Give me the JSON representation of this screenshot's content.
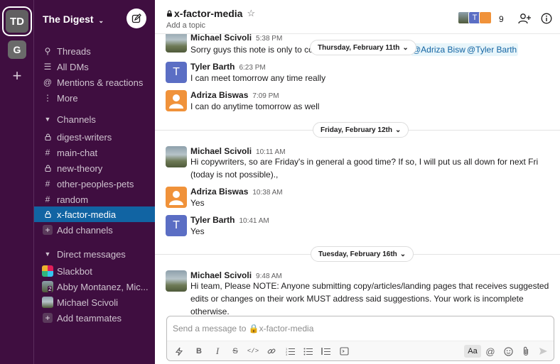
{
  "workspace": {
    "initials_active": "TD",
    "initials_second": "G",
    "add_symbol": "+",
    "name": "The Digest"
  },
  "sidebar": {
    "nav": [
      {
        "label": "Threads",
        "icon": "threads-icon"
      },
      {
        "label": "All DMs",
        "icon": "dms-icon"
      },
      {
        "label": "Mentions & reactions",
        "icon": "at-icon"
      },
      {
        "label": "More",
        "icon": "more-icon"
      }
    ],
    "channels_heading": "Channels",
    "channels": [
      {
        "label": "digest-writers",
        "icon": "lock-icon"
      },
      {
        "label": "main-chat",
        "icon": "hash-icon"
      },
      {
        "label": "new-theory",
        "icon": "lock-icon"
      },
      {
        "label": "other-peoples-pets",
        "icon": "hash-icon"
      },
      {
        "label": "random",
        "icon": "hash-icon"
      },
      {
        "label": "x-factor-media",
        "icon": "lock-icon",
        "selected": true
      }
    ],
    "add_channels": "Add channels",
    "dm_heading": "Direct messages",
    "dms": [
      {
        "label": "Slackbot"
      },
      {
        "label": "Abby Montanez, Mic...",
        "badge": "2"
      },
      {
        "label": "Michael Scivoli"
      }
    ],
    "add_teammates": "Add teammates"
  },
  "header": {
    "channel": "x-factor-media",
    "topic": "Add a topic",
    "member_count": "9",
    "avatar_letter": "T"
  },
  "dates": {
    "d1": "Thursday, February 11th",
    "d2": "Friday, February 12th",
    "d3": "Tuesday, February 16th"
  },
  "messages": [
    {
      "name": "Michael Scivoli",
      "time": "5:38 PM",
      "text": "Sorry guys this note is only to cop",
      "mentions": [
        "@Adriza Biswas",
        "@Tyler Barth"
      ]
    },
    {
      "name": "Tyler Barth",
      "time": "6:23 PM",
      "text": "I can meet tomorrow any time really",
      "avatar_letter": "T"
    },
    {
      "name": "Adriza Biswas",
      "time": "7:09 PM",
      "text": "I can do anytime tomorrow as well"
    },
    {
      "name": "Michael Scivoli",
      "time": "10:11 AM",
      "text": "Hi copywriters, so are Friday's in general a good time? If so, I will put us all down for next Fri (today is not possible).,"
    },
    {
      "name": "Adriza Biswas",
      "time": "10:38 AM",
      "text": "Yes"
    },
    {
      "name": "Tyler Barth",
      "time": "10:41 AM",
      "text": "Yes",
      "avatar_letter": "T"
    },
    {
      "name": "Michael Scivoli",
      "time": "9:48 AM",
      "text": "Hi team, Please NOTE: Anyone submitting copy/articles/landing pages that receives suggested edits or changes on their work MUST address said suggestions. Your work is incomplete otherwise."
    }
  ],
  "composer": {
    "placeholder": "Send a message to 🔒x-factor-media",
    "format_label": "Aa"
  },
  "colors": {
    "sidebar_bg": "#3f0e40",
    "selected": "#1164a3",
    "mention": "#1264a3"
  }
}
